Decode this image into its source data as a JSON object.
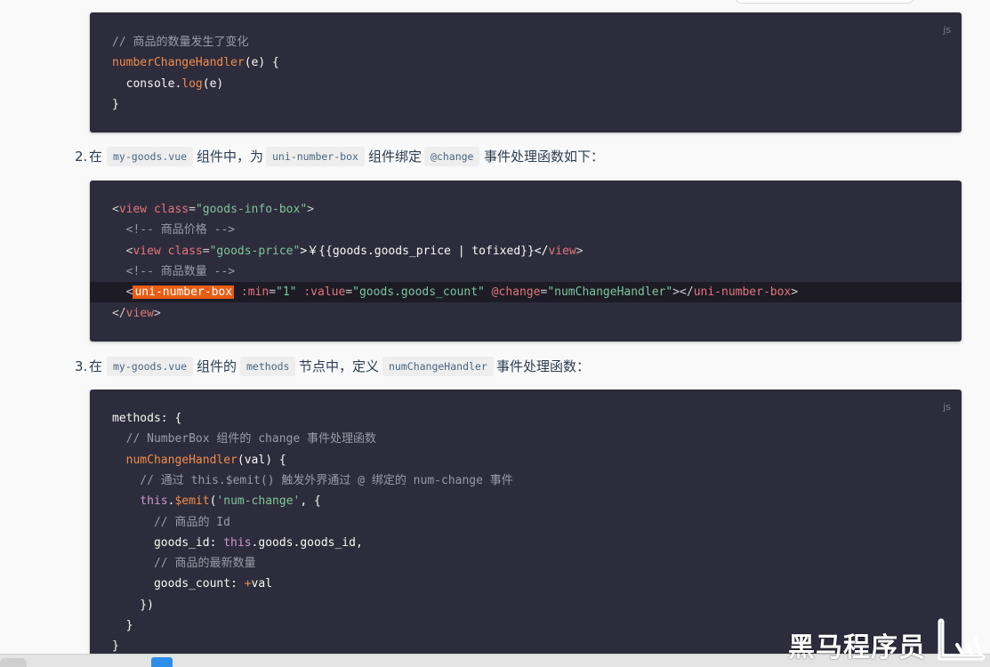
{
  "block1": {
    "lang": "js",
    "lines": [
      {
        "parts": [
          {
            "t": "// 商品的数量发生了变化",
            "c": "c-comment"
          }
        ]
      },
      {
        "parts": [
          {
            "t": "numberChangeHandler",
            "c": "c-fn"
          },
          {
            "t": "(e) {",
            "c": "c-plain"
          }
        ]
      },
      {
        "parts": [
          {
            "t": "  console.",
            "c": "c-plain"
          },
          {
            "t": "log",
            "c": "c-fn"
          },
          {
            "t": "(e)",
            "c": "c-plain"
          }
        ]
      },
      {
        "parts": [
          {
            "t": "}",
            "c": "c-plain"
          }
        ]
      }
    ]
  },
  "step2": {
    "number": "2.",
    "t1": "在",
    "code1": "my-goods.vue",
    "t2": "组件中，为",
    "code2": "uni-number-box",
    "t3": "组件绑定",
    "code3": "@change",
    "t4": "事件处理函数如下："
  },
  "block2": {
    "lines": [
      {
        "parts": [
          {
            "t": "<",
            "c": "c-punc"
          },
          {
            "t": "view",
            "c": "c-tag"
          },
          {
            "t": " class",
            "c": "c-attr"
          },
          {
            "t": "=",
            "c": "c-punc"
          },
          {
            "t": "\"goods-info-box\"",
            "c": "c-str"
          },
          {
            "t": ">",
            "c": "c-punc"
          }
        ]
      },
      {
        "parts": [
          {
            "t": "  <!-- 商品价格 -->",
            "c": "c-comment"
          }
        ]
      },
      {
        "parts": [
          {
            "t": "  <",
            "c": "c-punc"
          },
          {
            "t": "view",
            "c": "c-tag"
          },
          {
            "t": " class",
            "c": "c-attr"
          },
          {
            "t": "=",
            "c": "c-punc"
          },
          {
            "t": "\"goods-price\"",
            "c": "c-str"
          },
          {
            "t": ">￥{{goods.goods_price | tofixed}}</",
            "c": "c-plain"
          },
          {
            "t": "view",
            "c": "c-tag"
          },
          {
            "t": ">",
            "c": "c-punc"
          }
        ]
      },
      {
        "parts": [
          {
            "t": "  <!-- 商品数量 -->",
            "c": "c-comment"
          }
        ]
      },
      {
        "highlight": true,
        "parts": [
          {
            "t": "  <",
            "c": "c-punc"
          },
          {
            "t": "uni-number-box",
            "c": "c-hit"
          },
          {
            "t": " :min",
            "c": "c-attr"
          },
          {
            "t": "=",
            "c": "c-punc"
          },
          {
            "t": "\"1\"",
            "c": "c-str"
          },
          {
            "t": " :value",
            "c": "c-attr"
          },
          {
            "t": "=",
            "c": "c-punc"
          },
          {
            "t": "\"goods.goods_count\"",
            "c": "c-str"
          },
          {
            "t": " @change",
            "c": "c-attr"
          },
          {
            "t": "=",
            "c": "c-punc"
          },
          {
            "t": "\"numChangeHandler\"",
            "c": "c-str"
          },
          {
            "t": "></",
            "c": "c-punc"
          },
          {
            "t": "uni-number-box",
            "c": "c-tag"
          },
          {
            "t": ">",
            "c": "c-punc"
          }
        ]
      },
      {
        "parts": [
          {
            "t": "</",
            "c": "c-punc"
          },
          {
            "t": "view",
            "c": "c-tag"
          },
          {
            "t": ">",
            "c": "c-punc"
          }
        ]
      }
    ]
  },
  "step3": {
    "number": "3.",
    "t1": "在",
    "code1": "my-goods.vue",
    "t2": "组件的",
    "code2": "methods",
    "t3": "节点中，定义",
    "code3": "numChangeHandler",
    "t4": "事件处理函数："
  },
  "block3": {
    "lang": "js",
    "lines": [
      {
        "parts": [
          {
            "t": "methods",
            "c": "c-prop"
          },
          {
            "t": ": {",
            "c": "c-plain"
          }
        ]
      },
      {
        "parts": [
          {
            "t": "  // NumberBox 组件的 change 事件处理函数",
            "c": "c-comment"
          }
        ]
      },
      {
        "parts": [
          {
            "t": "  numChangeHandler",
            "c": "c-fn"
          },
          {
            "t": "(val) {",
            "c": "c-plain"
          }
        ]
      },
      {
        "parts": [
          {
            "t": "    // 通过 this.$emit() 触发外界通过 @ 绑定的 num-change 事件",
            "c": "c-comment"
          }
        ]
      },
      {
        "parts": [
          {
            "t": "    this",
            "c": "c-kw"
          },
          {
            "t": ".",
            "c": "c-plain"
          },
          {
            "t": "$emit",
            "c": "c-fn"
          },
          {
            "t": "(",
            "c": "c-plain"
          },
          {
            "t": "'num-change'",
            "c": "c-str"
          },
          {
            "t": ", {",
            "c": "c-plain"
          }
        ]
      },
      {
        "parts": [
          {
            "t": "      // 商品的 Id",
            "c": "c-comment"
          }
        ]
      },
      {
        "parts": [
          {
            "t": "      goods_id",
            "c": "c-prop"
          },
          {
            "t": ": ",
            "c": "c-plain"
          },
          {
            "t": "this",
            "c": "c-kw"
          },
          {
            "t": ".goods.goods_id,",
            "c": "c-plain"
          }
        ]
      },
      {
        "parts": [
          {
            "t": "      // 商品的最新数量",
            "c": "c-comment"
          }
        ]
      },
      {
        "parts": [
          {
            "t": "      goods_count",
            "c": "c-prop"
          },
          {
            "t": ": ",
            "c": "c-plain"
          },
          {
            "t": "+",
            "c": "c-fn"
          },
          {
            "t": "val",
            "c": "c-plain"
          }
        ]
      },
      {
        "parts": [
          {
            "t": "    })",
            "c": "c-plain"
          }
        ]
      },
      {
        "parts": [
          {
            "t": "  }",
            "c": "c-plain"
          }
        ]
      },
      {
        "parts": [
          {
            "t": "}",
            "c": "c-plain"
          }
        ]
      }
    ]
  },
  "watermark": {
    "text": "黑马程序员"
  }
}
